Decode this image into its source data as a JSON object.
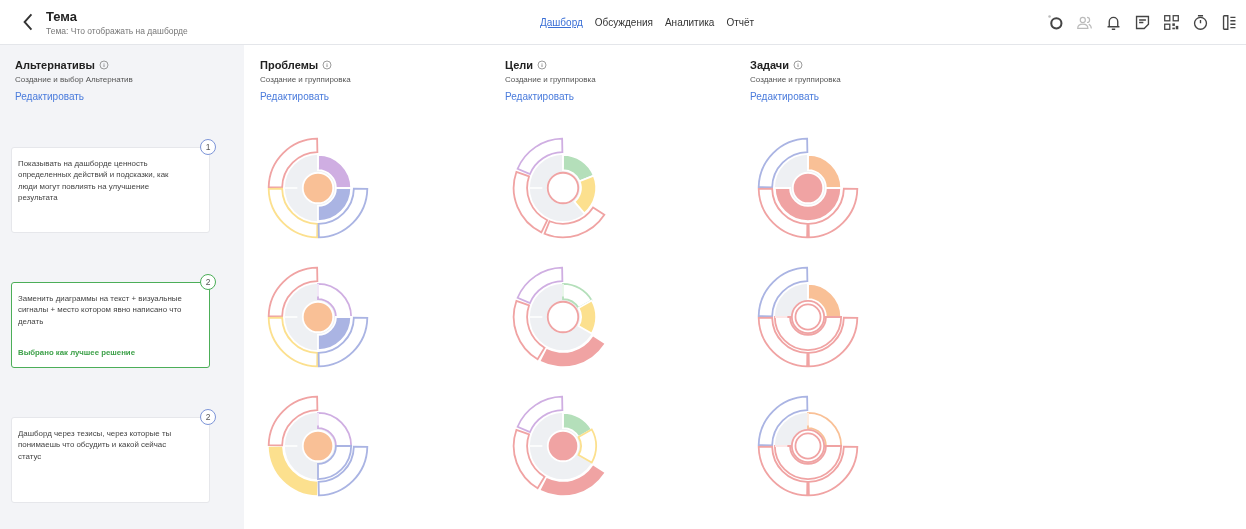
{
  "header": {
    "title": "Тема",
    "subtitle": "Тема: Что отображать на дашборде"
  },
  "tabs": [
    {
      "label": "Дашборд",
      "selected": true
    },
    {
      "label": "Обсуждения",
      "selected": false
    },
    {
      "label": "Аналитика",
      "selected": false
    },
    {
      "label": "Отчёт",
      "selected": false
    }
  ],
  "alternatives": {
    "title": "Альтернативы",
    "subtitle": "Создание и выбор Альтернатив",
    "edit_link": "Редактировать",
    "cards": [
      {
        "text": "Показывать на дашборде ценность определенных действий и подсказки, как люди могут повлиять на улучшение результата",
        "number": "1",
        "selected": false
      },
      {
        "text": "Заменить диаграммы на текст + визуальные сигналы + место котором явно написано что делать",
        "number": "2",
        "selected": true,
        "note": "Выбрано как лучшее решение"
      },
      {
        "text": "Дашборд через тезисы, через которые ты понимаешь что обсудить и какой сейчас статус",
        "number": "2",
        "selected": false
      }
    ]
  },
  "columns": [
    {
      "title": "Проблемы",
      "subtitle": "Создание и группировка",
      "edit_link": "Редактировать"
    },
    {
      "title": "Цели",
      "subtitle": "Создание и группировка",
      "edit_link": "Редактировать"
    },
    {
      "title": "Задачи",
      "subtitle": "Создание и группировка",
      "edit_link": "Редактировать"
    }
  ]
}
